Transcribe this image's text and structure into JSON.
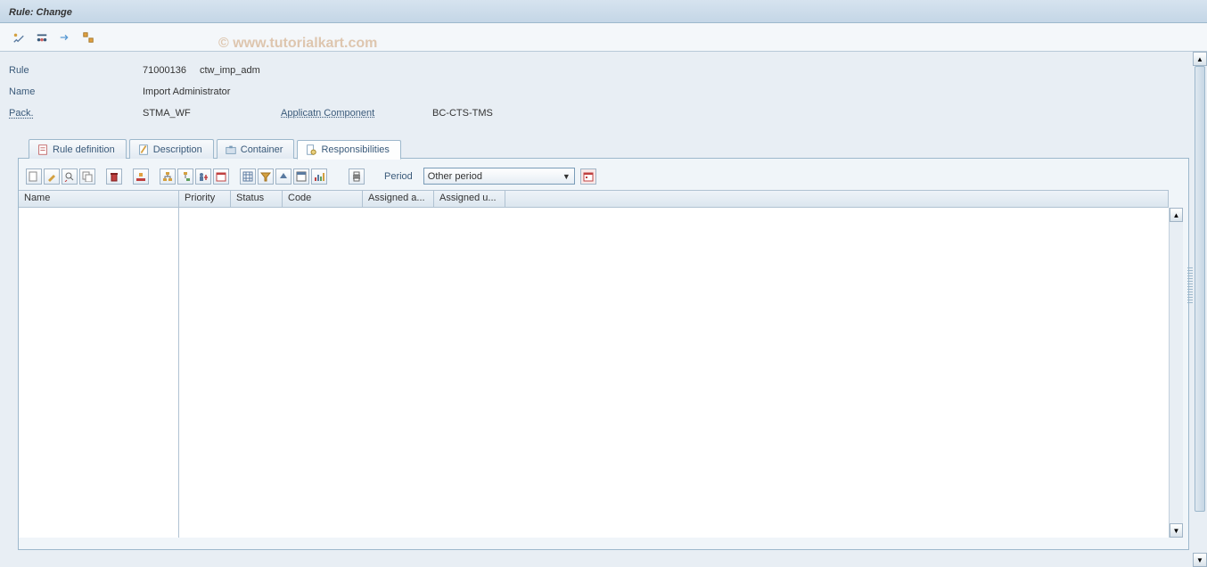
{
  "title": "Rule: Change",
  "watermark": "© www.tutorialkart.com",
  "form": {
    "rule_label": "Rule",
    "rule_id": "71000136",
    "rule_name": "ctw_imp_adm",
    "name_label": "Name",
    "name_value": "Import Administrator",
    "pack_label": "Pack.",
    "pack_value": "STMA_WF",
    "appcomp_label": "Applicatn Component",
    "appcomp_value": "BC-CTS-TMS"
  },
  "tabs": {
    "t1": "Rule definition",
    "t2": "Description",
    "t3": "Container",
    "t4": "Responsibilities"
  },
  "period": {
    "label": "Period",
    "value": "Other period"
  },
  "columns": {
    "c1": "Name",
    "c2": "Priority",
    "c3": "Status",
    "c4": "Code",
    "c5": "Assigned a...",
    "c6": "Assigned u..."
  }
}
